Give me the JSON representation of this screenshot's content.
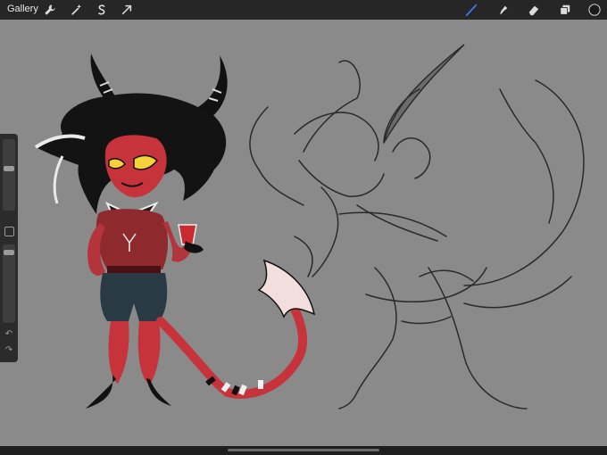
{
  "app": {
    "gallery_label": "Gallery"
  },
  "toolbar": {
    "left_tools": [
      "wrench-icon",
      "magic-wand-icon",
      "selection-s-icon",
      "transform-arrow-icon"
    ],
    "right_tools": [
      "brush-icon",
      "smudge-icon",
      "eraser-icon",
      "layers-icon",
      "color-swatch-icon"
    ],
    "active_tool": "brush-icon",
    "active_color": "#1a1a1a",
    "accent_color": "#3a7be8"
  },
  "sidebar": {
    "brush_size_level": 0.25,
    "opacity_level": 0.05,
    "undo_icon": "undo-icon",
    "redo_icon": "redo-icon"
  },
  "canvas": {
    "background_color": "#8a8a8a",
    "content": "illustration"
  }
}
